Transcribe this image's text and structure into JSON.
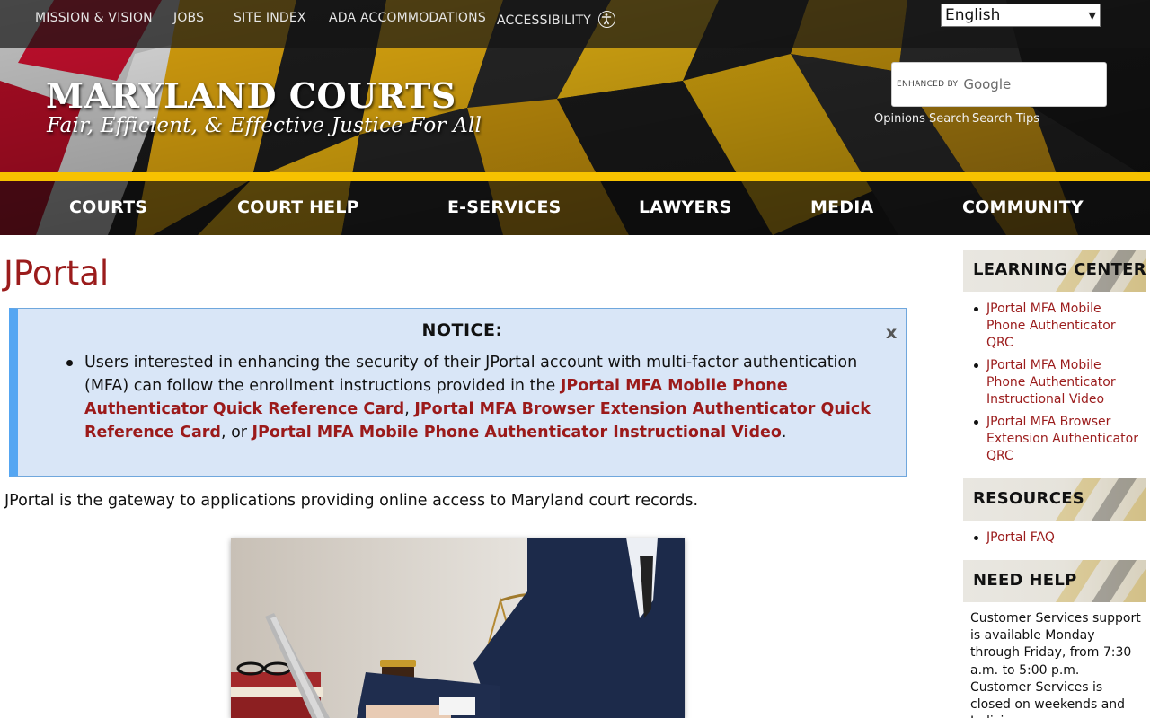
{
  "utility_nav": {
    "mission": "MISSION & VISION",
    "jobs": "JOBS",
    "site_index": "SITE INDEX",
    "ada": "ADA ACCOMMODATIONS",
    "accessibility": "ACCESSIBILITY"
  },
  "language": {
    "selected": "English"
  },
  "branding": {
    "title": "MARYLAND COURTS",
    "tagline": "Fair, Efficient, & Effective Justice For All"
  },
  "search": {
    "enhanced_by": "ENHANCED BY",
    "provider": "Google",
    "opinions_link": "Opinions Search",
    "tips_link": "Search Tips"
  },
  "main_nav": [
    "COURTS",
    "COURT HELP",
    "E-SERVICES",
    "LAWYERS",
    "MEDIA",
    "COMMUNITY"
  ],
  "page": {
    "title": "JPortal",
    "intro": "JPortal is the gateway to applications providing online access to Maryland court records."
  },
  "notice": {
    "heading": "NOTICE:",
    "close": "x",
    "text_before": "Users interested in enhancing the security of their JPortal account with multi-factor authentication (MFA) can follow the enrollment instructions provided in the ",
    "link1": "JPortal MFA Mobile Phone Authenticator Quick Reference Card",
    "sep1": ", ",
    "link2": "JPortal MFA Browser Extension Authenticator Quick Reference Card",
    "sep2": ", or ",
    "link3": "JPortal MFA Mobile Phone Authenticator Instructional Video",
    "text_after": "."
  },
  "sidebar": {
    "learning_center": {
      "heading": "LEARNING CENTER",
      "items": [
        "JPortal MFA Mobile Phone Authenticator QRC",
        "JPortal MFA Mobile Phone Authenticator Instructional Video",
        "JPortal MFA Browser Extension Authenticator QRC"
      ]
    },
    "resources": {
      "heading": "RESOURCES",
      "items": [
        "JPortal FAQ"
      ]
    },
    "need_help": {
      "heading": "NEED HELP",
      "text": "Customer Services support is available Monday through Friday, from 7:30 a.m. to 5:00 p.m. Customer Services is closed on weekends and Judiciary"
    }
  },
  "colors": {
    "accent_red": "#9b1c1c",
    "flag_gold": "#f7c200",
    "notice_bg": "#d9e6f7",
    "notice_border": "#55a6f2"
  }
}
